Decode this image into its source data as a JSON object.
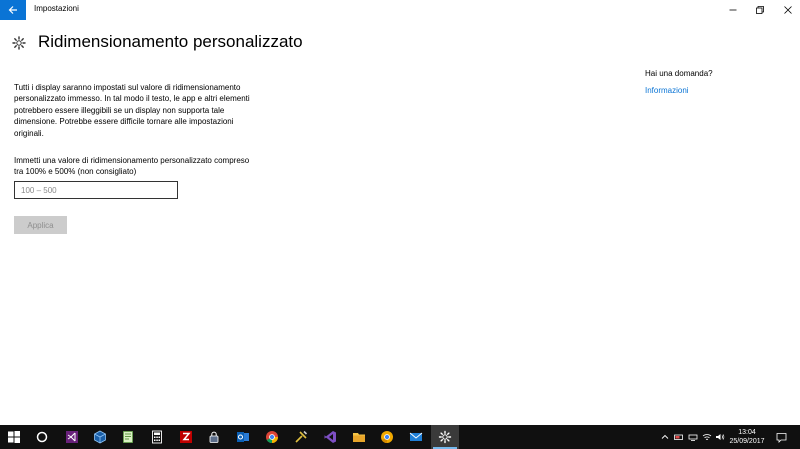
{
  "window": {
    "title": "Impostazioni",
    "back_icon": "arrow-left-icon",
    "controls": [
      "minimize-icon",
      "maximize-icon",
      "close-icon"
    ]
  },
  "page": {
    "icon": "gear-icon",
    "title": "Ridimensionamento personalizzato",
    "description_lines": [
      "Tutti i display saranno impostati sul valore di ridimensionamento",
      "personalizzato immesso. In tal modo il testo, le app e altri elementi",
      "potrebbero essere illeggibili se un display non supporta tale",
      "dimensione. Potrebbe essere difficile tornare alle impostazioni",
      "originali."
    ],
    "input_label_lines": [
      "Immetti una valore di ridimensionamento personalizzato compreso",
      "tra 100% e 500% (non consigliato)"
    ],
    "input": {
      "value": "",
      "placeholder": "100 – 500"
    },
    "apply_label": "Applica"
  },
  "aside": {
    "question": "Hai una domanda?",
    "link": "Informazioni"
  },
  "taskbar": {
    "apps": [
      "windows-start-icon",
      "cortana-icon",
      "visual-studio-icon",
      "virtualbox-icon",
      "notepad-plus-icon",
      "calculator-icon",
      "filezilla-icon",
      "keepass-icon",
      "outlook-icon",
      "chrome-icon",
      "tools-icon",
      "visual-studio-code-icon",
      "file-explorer-icon",
      "chrome-canary-icon",
      "mail-icon",
      "settings-icon"
    ],
    "tray": [
      "chevron-up-icon",
      "battery-icon",
      "network-icon",
      "wifi-icon",
      "volume-icon"
    ],
    "time": "13:04",
    "date": "25/09/2017",
    "notifications_icon": "action-center-icon"
  },
  "colors": {
    "accent": "#0a74d5",
    "taskbar": "#101010"
  }
}
